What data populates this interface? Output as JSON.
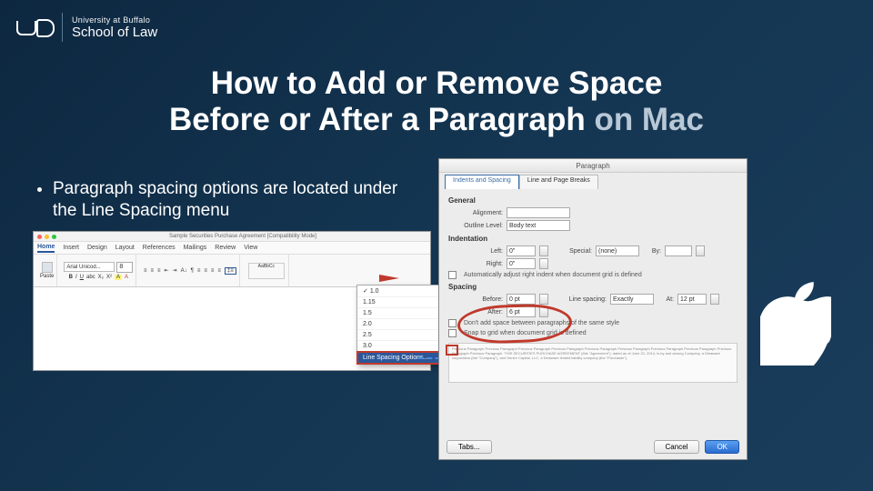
{
  "logo": {
    "top": "University at Buffalo",
    "bottom": "School of Law"
  },
  "title": {
    "line1": "How to Add or Remove Space",
    "line2_a": "Before or After a Paragraph ",
    "line2_b": "on Mac"
  },
  "bullet": "Paragraph spacing options are located under the Line Spacing menu",
  "word": {
    "window_title": "Sample Securities Purchase Agreement [Compatibility Mode]",
    "tabs": [
      "Home",
      "Insert",
      "Design",
      "Layout",
      "References",
      "Mailings",
      "Review",
      "View"
    ],
    "font_name": "Arial Unicod...",
    "font_size": "8",
    "dropdown": {
      "items": [
        "1.0",
        "1.15",
        "1.5",
        "2.0",
        "2.5",
        "3.0"
      ],
      "highlighted": "Line Spacing Options..."
    }
  },
  "dialog": {
    "title": "Paragraph",
    "tabs": {
      "active": "Indents and Spacing",
      "other": "Line and Page Breaks"
    },
    "general": {
      "header": "General",
      "alignment_label": "Alignment:",
      "alignment_value": "",
      "outline_label": "Outline Level:",
      "outline_value": "Body text"
    },
    "indentation": {
      "header": "Indentation",
      "left_label": "Left:",
      "left_value": "0\"",
      "right_label": "Right:",
      "right_value": "0\"",
      "special_label": "Special:",
      "special_value": "(none)",
      "by_label": "By:",
      "by_value": "",
      "auto_check": "Automatically adjust right indent when document grid is defined"
    },
    "spacing": {
      "header": "Spacing",
      "before_label": "Before:",
      "before_value": "0 pt",
      "after_label": "After:",
      "after_value": "6 pt",
      "line_label": "Line spacing:",
      "line_value": "Exactly",
      "at_label": "At:",
      "at_value": "12 pt",
      "chk1": "Don't add space between paragraphs of the same style",
      "chk2": "Snap to grid when document grid is defined"
    },
    "preview": "Previous Paragraph Previous Paragraph Previous Paragraph Previous Paragraph Previous Paragraph Previous Paragraph Previous Paragraph Previous Paragraph Previous Paragraph Previous Paragraph. THIS SECURITIES PURCHASE AGREEMENT (this \"Agreement\"), dated as of June 22, 2014, is by and among Company, a Delaware corporation (the \"Company\"), and Senior Capital, LLC, a Delaware limited liability company (the \"Purchaser\").",
    "buttons": {
      "tabs": "Tabs...",
      "cancel": "Cancel",
      "ok": "OK"
    }
  }
}
